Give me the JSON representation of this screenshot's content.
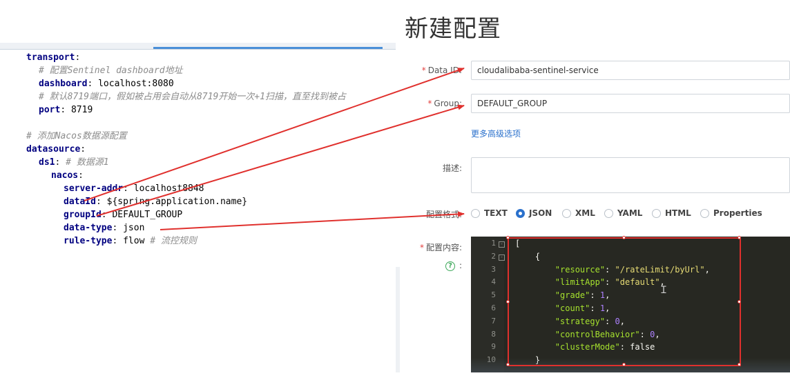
{
  "yaml_editor": {
    "lines": [
      {
        "indent": 0,
        "key": "transport",
        "sep": ":",
        "value": "",
        "comment": ""
      },
      {
        "indent": 1,
        "key": "",
        "sep": "",
        "value": "",
        "comment": "# 配置Sentinel dashboard地址"
      },
      {
        "indent": 1,
        "key": "dashboard",
        "sep": ": ",
        "value": "localhost:8080",
        "comment": ""
      },
      {
        "indent": 1,
        "key": "",
        "sep": "",
        "value": "",
        "comment": "# 默认8719端口，假如被占用会自动从8719开始一次+1扫描，直至找到被占"
      },
      {
        "indent": 1,
        "key": "port",
        "sep": ": ",
        "value": "8719",
        "comment": ""
      },
      {
        "indent": 0,
        "key": "",
        "sep": "",
        "value": "",
        "comment": ""
      },
      {
        "indent": 0,
        "key": "",
        "sep": "",
        "value": "",
        "comment": "# 添加Nacos数据源配置"
      },
      {
        "indent": 0,
        "key": "datasource",
        "sep": ":",
        "value": "",
        "comment": ""
      },
      {
        "indent": 1,
        "key": "ds1",
        "sep": ": ",
        "value": "",
        "comment": "# 数据源1"
      },
      {
        "indent": 2,
        "key": "nacos",
        "sep": ":",
        "value": "",
        "comment": ""
      },
      {
        "indent": 3,
        "key": "server-addr",
        "sep": ": ",
        "value": "localhost8848",
        "comment": ""
      },
      {
        "indent": 3,
        "key": "dataId",
        "sep": ": ",
        "value": "${spring.application.name}",
        "comment": ""
      },
      {
        "indent": 3,
        "key": "groupId",
        "sep": ": ",
        "value": "DEFAULT_GROUP",
        "comment": ""
      },
      {
        "indent": 3,
        "key": "data-type",
        "sep": ": ",
        "value": "json",
        "comment": ""
      },
      {
        "indent": 3,
        "key": "rule-type",
        "sep": ": ",
        "value": "flow",
        "comment": "# 流控规则"
      }
    ]
  },
  "nacos_form": {
    "title": "新建配置",
    "required_mark": "*",
    "data_id": {
      "label": "Data ID:",
      "value": "cloudalibaba-sentinel-service"
    },
    "group": {
      "label": "Group:",
      "value": "DEFAULT_GROUP"
    },
    "advanced_link": "更多高级选项",
    "description": {
      "label": "描述:",
      "value": ""
    },
    "format": {
      "label": "配置格式:",
      "options": [
        "TEXT",
        "JSON",
        "XML",
        "YAML",
        "HTML",
        "Properties"
      ],
      "selected": "JSON"
    },
    "content": {
      "label": "配置内容:",
      "help_symbol": "?",
      "help_colon": ":"
    }
  },
  "code_editor": {
    "line_numbers": [
      "1",
      "2",
      "3",
      "4",
      "5",
      "6",
      "7",
      "8",
      "9",
      "10"
    ],
    "lines": [
      "[",
      "    {",
      "        \"resource\": \"/rateLimit/byUrl\",",
      "        \"limitApp\": \"default\",",
      "        \"grade\": 1,",
      "        \"count\": 1,",
      "        \"strategy\": 0,",
      "        \"controlBehavior\": 0,",
      "        \"clusterMode\": false",
      "    }"
    ]
  },
  "colors": {
    "arrow": "#e0302d",
    "accent": "#2b71cc",
    "editor_bg": "#272822"
  }
}
